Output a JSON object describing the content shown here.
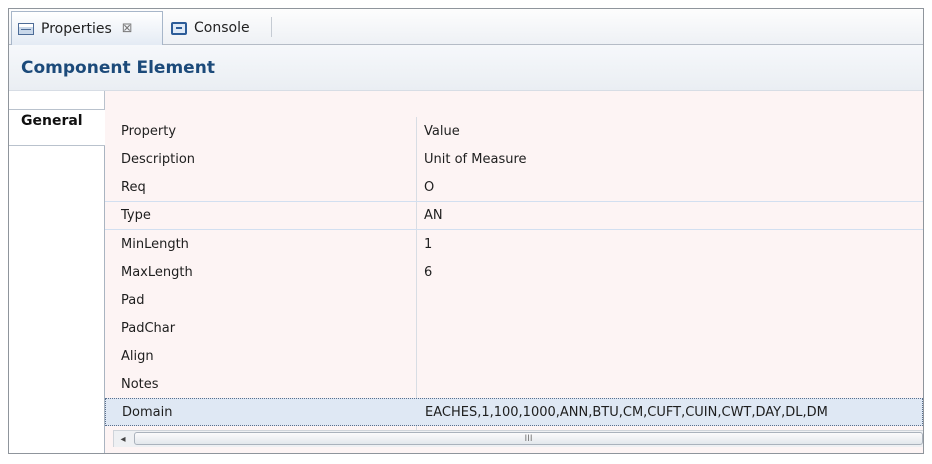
{
  "tabs": [
    {
      "label": "Properties",
      "icon": "properties-view-icon",
      "active": true,
      "closable": true
    },
    {
      "label": "Console",
      "icon": "console-view-icon",
      "active": false
    }
  ],
  "heading": "Component Element",
  "side_tabs": [
    {
      "label": "General",
      "active": true
    }
  ],
  "table": {
    "columns": [
      "Property",
      "Value"
    ],
    "rows": [
      {
        "property": "Description",
        "value": "Unit of Measure"
      },
      {
        "property": "Req",
        "value": "O"
      },
      {
        "property": "Type",
        "value": "AN"
      },
      {
        "property": "MinLength",
        "value": "1"
      },
      {
        "property": "MaxLength",
        "value": "6"
      },
      {
        "property": "Pad",
        "value": ""
      },
      {
        "property": "PadChar",
        "value": ""
      },
      {
        "property": "Align",
        "value": ""
      },
      {
        "property": "Notes",
        "value": ""
      },
      {
        "property": "Domain",
        "value": "EACHES,1,100,1000,ANN,BTU,CM,CUFT,CUIN,CWT,DAY,DL,DM"
      }
    ],
    "selected_row": "Domain"
  },
  "scrollbar": {
    "left_arrow": "◂",
    "grip": "III"
  },
  "colors": {
    "heading": "#1c4a7a",
    "content_bg": "#fdf4f4",
    "selection": "#dfe8f4"
  }
}
